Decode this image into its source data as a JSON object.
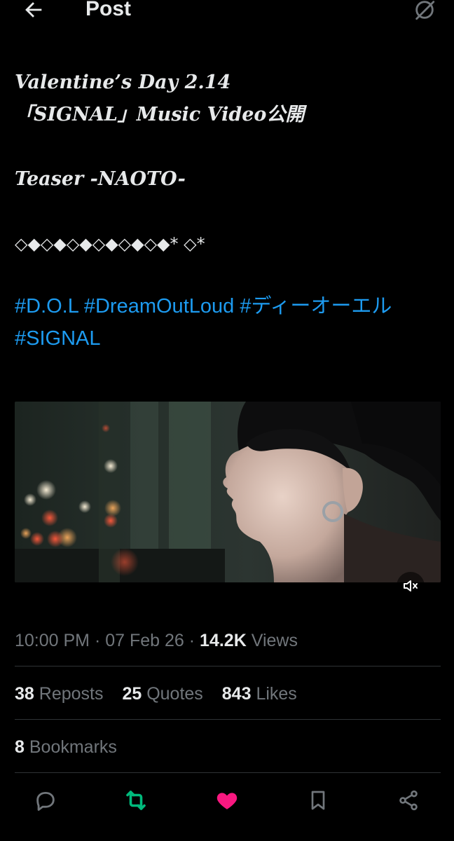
{
  "header": {
    "title": "Post",
    "back_icon": "arrow-left-icon",
    "grok_icon": "grok-icon"
  },
  "tweet": {
    "line1": "Valentine’s Day 2.14",
    "line2": "「SIGNAL」Music Video公開",
    "line3": "Teaser -NAOTO-",
    "line4": "◇◆◇◆◇◆◇◆◇◆◇◆* ◇*",
    "hashtags": [
      "#D.O.L",
      "#DreamOutLoud",
      "#ディーオーエル",
      "#SIGNAL"
    ]
  },
  "media": {
    "mute_icon": "mute-icon"
  },
  "meta": {
    "time": "10:00 PM",
    "separator": " · ",
    "date": "07 Feb 26",
    "views_count": "14.2K",
    "views_label": "Views"
  },
  "stats": {
    "reposts_count": "38",
    "reposts_label": "Reposts",
    "quotes_count": "25",
    "quotes_label": "Quotes",
    "likes_count": "843",
    "likes_label": "Likes",
    "bookmarks_count": "8",
    "bookmarks_label": "Bookmarks"
  },
  "actions": {
    "reply_icon": "reply-icon",
    "repost_icon": "repost-icon",
    "like_icon": "heart-icon",
    "bookmark_icon": "bookmark-icon",
    "share_icon": "share-icon"
  },
  "colors": {
    "background": "#000000",
    "text": "#e7e9ea",
    "secondary": "#71767b",
    "link": "#1d9bf0",
    "repost_active": "#00ba7c",
    "like_active": "#f91880",
    "divider": "#2f3336"
  }
}
